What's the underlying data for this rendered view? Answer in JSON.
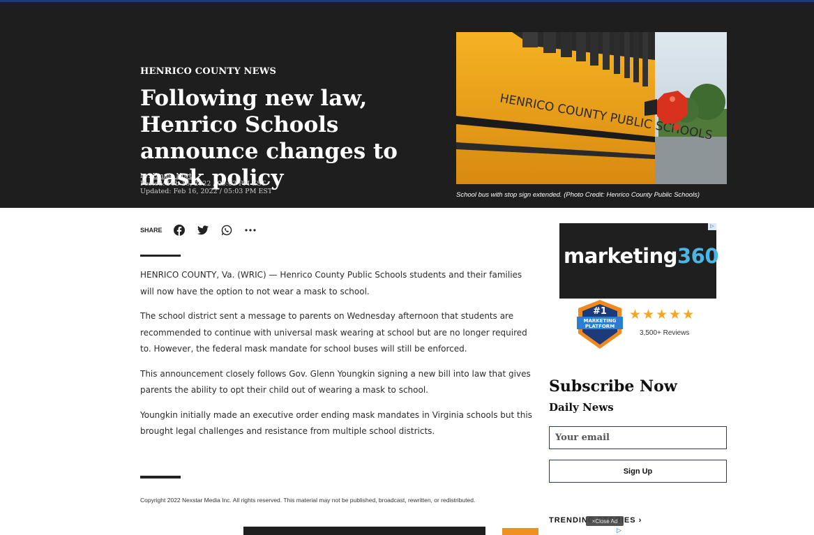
{
  "hero": {
    "kicker": "HENRICO COUNTY NEWS",
    "headline": "Following new law, Henrico Schools announce changes to mask policy",
    "byline_prefix": "by:",
    "author": "Emma North",
    "posted": "Posted: Feb 16, 2022 / 05:03 PM EST",
    "updated": "Updated: Feb 16, 2022 / 05:03 PM EST",
    "image_bus_text": "HENRICO COUNTY PUBLIC SCHOOLS",
    "caption": "School bus with stop sign extended. (Photo Credit: Henrico County Public Schools)"
  },
  "share": {
    "label": "SHARE",
    "icons": [
      "facebook-icon",
      "twitter-icon",
      "whatsapp-icon",
      "more-icon"
    ]
  },
  "article": {
    "paragraphs": [
      "HENRICO COUNTY, Va. (WRIC) — Henrico County Public Schools students and their families will now have the option to not wear a mask to school.",
      "The school district sent a message to parents on Wednesday afternoon that students are recommended to continue with universal mask wearing at school but are no longer required to. However, the federal mask mandate for school buses will still be enforced.",
      "This announcement closely follows Gov. Glenn Youngkin signing a new bill into law that gives parents the ability to opt their child out of wearing a mask to school.",
      "Youngkin initially made an executive order ending mask mandates in Virginia schools but this brought legal challenges and resistance from multiple school districts."
    ],
    "copyright": "Copyright 2022 Nexstar Media Inc. All rights reserved. This material may not be published, broadcast, rewritten, or redistributed."
  },
  "sidebar_ad": {
    "brand_word": "marketing",
    "brand_num": "360",
    "badge_rank": "#1",
    "badge_line1": "MARKETING",
    "badge_line2": "PLATFORM",
    "stars": "★★★★★",
    "reviews": "3,500+ Reviews"
  },
  "subscribe": {
    "title": "Subscribe Now",
    "subtitle": "Daily News",
    "email_placeholder": "Your email",
    "button": "Sign Up"
  },
  "trending": {
    "label": "TRENDING STORIES",
    "close_ad": "Close Ad"
  },
  "colors": {
    "hero_bg": "#1e1e1e",
    "accent_blue": "#1d3a7a",
    "bus_yellow": "#f2a71b"
  }
}
